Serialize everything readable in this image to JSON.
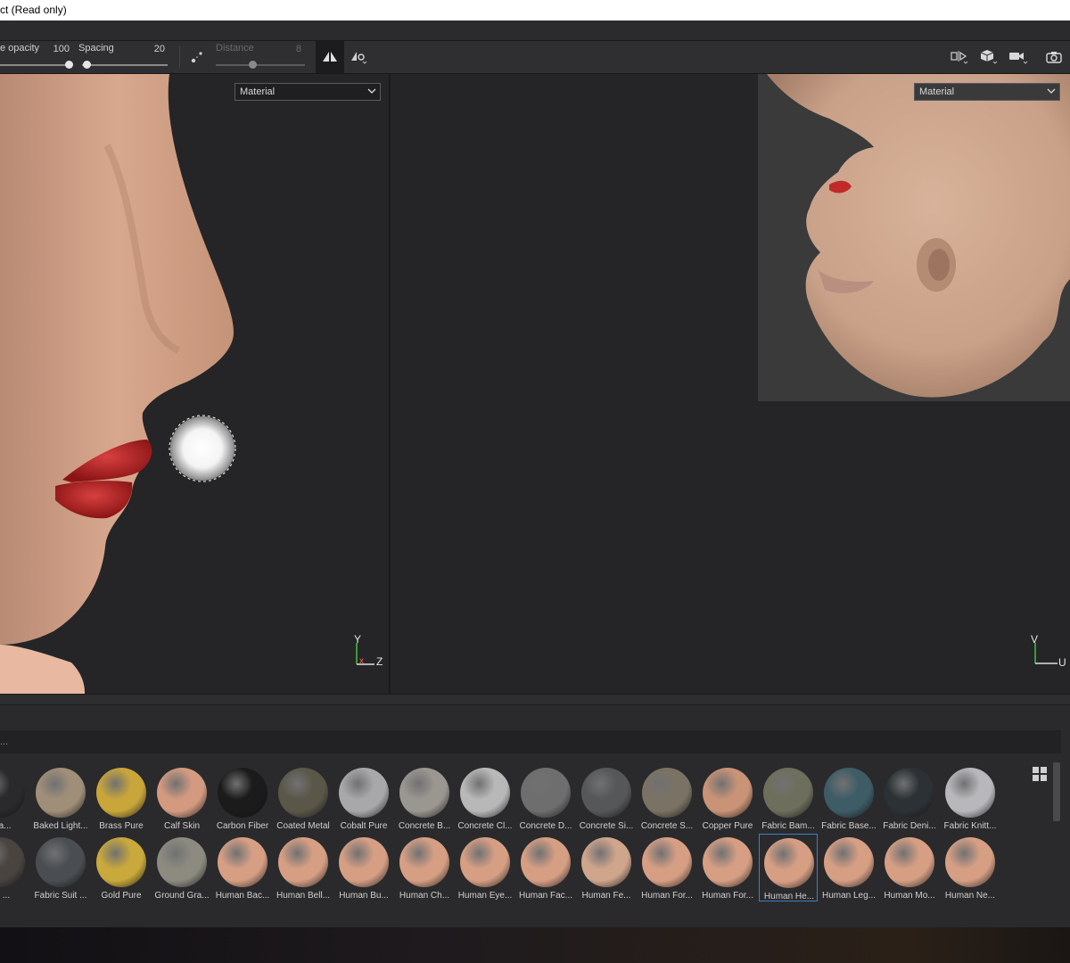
{
  "window": {
    "title": "ct (Read only)"
  },
  "toolbar": {
    "opacity_label": "e opacity",
    "opacity_value": "100",
    "spacing_label": "Spacing",
    "spacing_value": "20",
    "distance_label": "Distance",
    "distance_value": "8"
  },
  "viewport3d": {
    "channel": "Material",
    "axis_y": "Y",
    "axis_x": "x",
    "axis_z": "Z"
  },
  "viewport2d": {
    "channel": "Material",
    "axis_v": "V",
    "axis_u": "U"
  },
  "shelf": {
    "search_placeholder": "...",
    "row1": [
      {
        "label": "Lea...",
        "color": "#2a2a2c"
      },
      {
        "label": "Baked Light...",
        "color": "#a08f78"
      },
      {
        "label": "Brass Pure",
        "color": "#c9a63a"
      },
      {
        "label": "Calf Skin",
        "color": "#d39a80"
      },
      {
        "label": "Carbon Fiber",
        "color": "#1b1b1c"
      },
      {
        "label": "Coated Metal",
        "color": "#5a5749"
      },
      {
        "label": "Cobalt Pure",
        "color": "#a8a8aa"
      },
      {
        "label": "Concrete B...",
        "color": "#9a9690"
      },
      {
        "label": "Concrete Cl...",
        "color": "#b8b8b8"
      },
      {
        "label": "Concrete D...",
        "color": "#6e6e6e"
      },
      {
        "label": "Concrete Si...",
        "color": "#555758"
      },
      {
        "label": "Concrete S...",
        "color": "#7a7264"
      },
      {
        "label": "Copper Pure",
        "color": "#c99377"
      },
      {
        "label": "Fabric Bam...",
        "color": "#6e6e5c"
      },
      {
        "label": "Fabric Base...",
        "color": "#3e5c66"
      },
      {
        "label": "Fabric Deni...",
        "color": "#2c3135"
      },
      {
        "label": "Fabric Knitt...",
        "color": "#b8b8bc"
      }
    ],
    "row2": [
      {
        "label": "oft ...",
        "color": "#4a4440"
      },
      {
        "label": "Fabric Suit ...",
        "color": "#4a4e52"
      },
      {
        "label": "Gold Pure",
        "color": "#c9a83c"
      },
      {
        "label": "Ground Gra...",
        "color": "#8d8b80"
      },
      {
        "label": "Human Bac...",
        "color": "#d69f84"
      },
      {
        "label": "Human Bell...",
        "color": "#d69f84"
      },
      {
        "label": "Human Bu...",
        "color": "#d69f84"
      },
      {
        "label": "Human Ch...",
        "color": "#d69f84"
      },
      {
        "label": "Human Eye...",
        "color": "#d69f84"
      },
      {
        "label": "Human Fac...",
        "color": "#d69f84"
      },
      {
        "label": "Human Fe...",
        "color": "#cfa58c"
      },
      {
        "label": "Human For...",
        "color": "#d69f84"
      },
      {
        "label": "Human For...",
        "color": "#d69f84"
      },
      {
        "label": "Human He...",
        "color": "#d69f84"
      },
      {
        "label": "Human Leg...",
        "color": "#d69f84"
      },
      {
        "label": "Human Mo...",
        "color": "#d69f84"
      },
      {
        "label": "Human Ne...",
        "color": "#d69f84"
      }
    ],
    "selected_index_row2": 13
  },
  "icons": [
    "opacity-slider-icon",
    "spacing-slider-icon",
    "lazy-mouse-icon",
    "symmetry-icon",
    "symmetry-settings-icon",
    "uv-split-icon",
    "display-mode-icon",
    "camera-icon",
    "screenshot-icon",
    "grid-view-icon"
  ]
}
